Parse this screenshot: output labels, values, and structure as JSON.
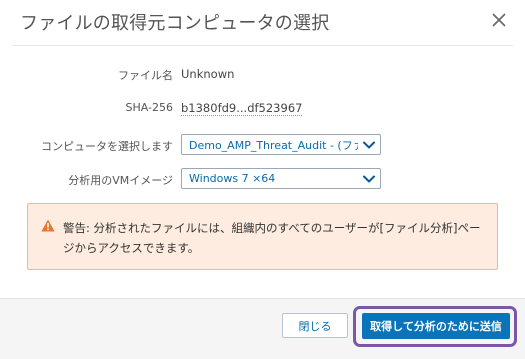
{
  "dialog": {
    "title": "ファイルの取得元コンピュータの選択"
  },
  "fields": {
    "file_name_label": "ファイル名",
    "file_name_value": "Unknown",
    "sha_label": "SHA-256",
    "sha_value": "b1380fd9...df523967",
    "computer_label": "コンピュータを選択します",
    "computer_selected": "Demo_AMP_Threat_Audit - (ファ",
    "vm_label": "分析用のVMイメージ",
    "vm_selected": "Windows 7 ×64"
  },
  "warning": {
    "prefix": "警告:",
    "text": " 分析されたファイルには、組織内のすべてのユーザーが[ファイル分析]ページからアクセスできます。",
    "color_bg": "#fdecdf",
    "color_icon": "#e8772e"
  },
  "buttons": {
    "close_label": "閉じる",
    "submit_label": "取得して分析のために送信"
  },
  "colors": {
    "primary": "#0b73b8",
    "highlight": "#7c57a6"
  },
  "icons": {
    "close": "close-icon",
    "chevron": "chevron-down-icon",
    "warning": "warning-icon"
  }
}
